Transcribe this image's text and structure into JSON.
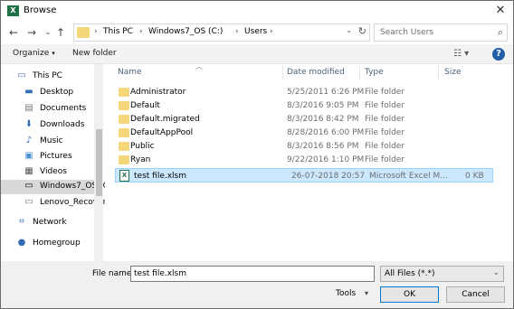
{
  "window": {
    "title": "Browse"
  },
  "address": {
    "crumbs": [
      "This PC",
      "Windows7_OS (C:)",
      "Users"
    ]
  },
  "search": {
    "placeholder": "Search Users"
  },
  "toolbar": {
    "organize": "Organize",
    "new_folder": "New folder"
  },
  "nav": {
    "items": [
      {
        "label": "This PC",
        "icon": "computer-icon"
      },
      {
        "label": "Desktop",
        "icon": "desktop-icon"
      },
      {
        "label": "Documents",
        "icon": "documents-icon"
      },
      {
        "label": "Downloads",
        "icon": "downloads-icon"
      },
      {
        "label": "Music",
        "icon": "music-icon"
      },
      {
        "label": "Pictures",
        "icon": "pictures-icon"
      },
      {
        "label": "Videos",
        "icon": "videos-icon"
      },
      {
        "label": "Windows7_OS (C",
        "icon": "drive-icon"
      },
      {
        "label": "Lenovo_Recover",
        "icon": "drive-icon"
      },
      {
        "label": "Network",
        "icon": "network-icon"
      },
      {
        "label": "Homegroup",
        "icon": "homegroup-icon"
      }
    ]
  },
  "columns": {
    "name": "Name",
    "date": "Date modified",
    "type": "Type",
    "size": "Size"
  },
  "files": [
    {
      "name": "Administrator",
      "date": "5/25/2011 6:26 PM",
      "type": "File folder",
      "size": "",
      "kind": "folder"
    },
    {
      "name": "Default",
      "date": "8/3/2016 9:05 PM",
      "type": "File folder",
      "size": "",
      "kind": "folder"
    },
    {
      "name": "Default.migrated",
      "date": "8/3/2016 8:42 PM",
      "type": "File folder",
      "size": "",
      "kind": "folder"
    },
    {
      "name": "DefaultAppPool",
      "date": "8/28/2016 6:00 PM",
      "type": "File folder",
      "size": "",
      "kind": "folder"
    },
    {
      "name": "Public",
      "date": "8/3/2016 8:56 PM",
      "type": "File folder",
      "size": "",
      "kind": "folder"
    },
    {
      "name": "Ryan",
      "date": "9/22/2016 1:10 PM",
      "type": "File folder",
      "size": "",
      "kind": "folder"
    },
    {
      "name": "test file.xlsm",
      "date": "26-07-2018 20:57",
      "type": "Microsoft Excel M...",
      "size": "0 KB",
      "kind": "excel"
    }
  ],
  "bottom": {
    "file_name_label": "File name:",
    "file_name_value": "test file.xlsm",
    "filter": "All Files (*.*)",
    "tools": "Tools",
    "ok": "OK",
    "cancel": "Cancel"
  },
  "colors": {
    "selected_row": "#cce8ff",
    "accent": "#0078d7",
    "folder": "#f5d77b"
  }
}
